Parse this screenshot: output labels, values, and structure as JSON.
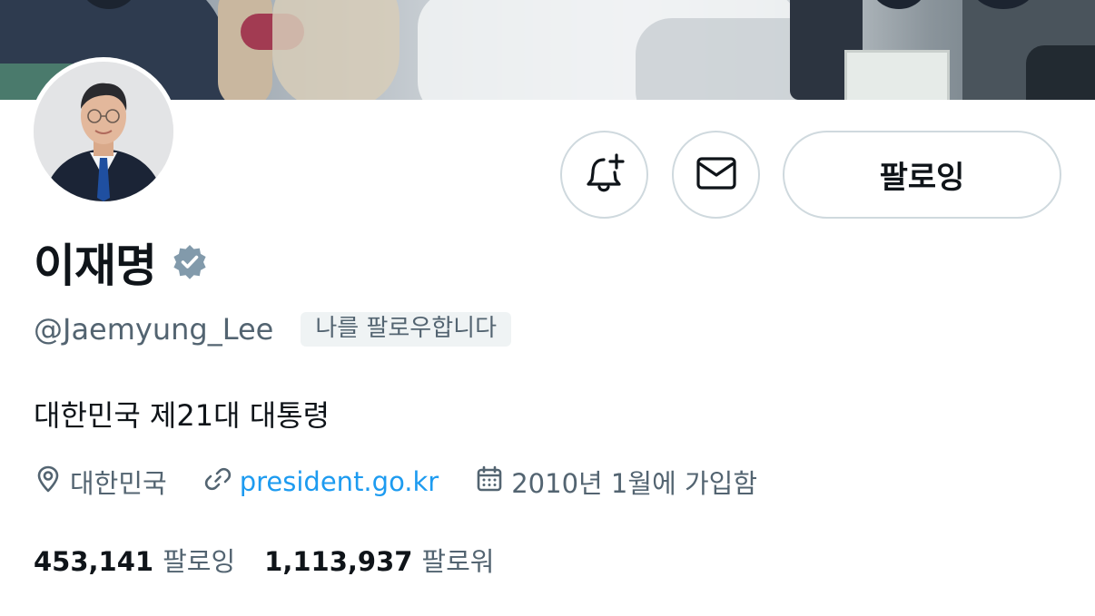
{
  "profile": {
    "display_name": "이재명",
    "handle": "@Jaemyung_Lee",
    "follows_you_badge": "나를 팔로우합니다",
    "bio": "대한민국 제21대 대통령",
    "verified_badge_color": "#829aab"
  },
  "actions": {
    "notify_icon": "bell-plus-icon",
    "message_icon": "envelope-icon",
    "follow_label": "팔로잉"
  },
  "meta": {
    "location_icon": "location-pin-icon",
    "location": "대한민국",
    "link_icon": "link-icon",
    "website": "president.go.kr",
    "calendar_icon": "calendar-icon",
    "joined": "2010년 1월에 가입함"
  },
  "stats": {
    "following_count": "453,141",
    "following_label": "팔로잉",
    "followers_count": "1,113,937",
    "followers_label": "팔로워"
  },
  "colors": {
    "link": "#1d9bf0",
    "secondary_text": "#536471",
    "primary_text": "#0f1419",
    "border": "#cfd9de"
  }
}
